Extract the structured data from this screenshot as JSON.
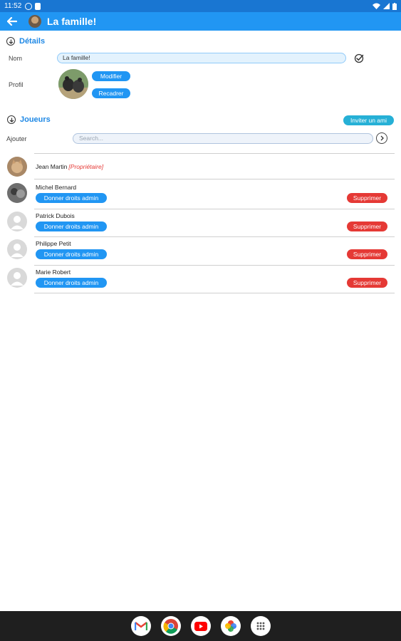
{
  "status_bar": {
    "time": "11:52"
  },
  "app_bar": {
    "title": "La famille!"
  },
  "details": {
    "heading": "Détails",
    "name_label": "Nom",
    "name_value": "La famille!",
    "profile_label": "Profil",
    "modify_label": "Modifier",
    "recrop_label": "Recadrer"
  },
  "players": {
    "heading": "Joueurs",
    "invite_label": "Inviter un ami",
    "add_label": "Ajouter",
    "search_placeholder": "Search...",
    "owner_tag": "[Propriétaire]",
    "admin_label": "Donner droits admin",
    "delete_label": "Supprimer",
    "list": [
      {
        "name": "Jean Martin",
        "owner": true,
        "avatar": "cat-photo"
      },
      {
        "name": "Michel Bernard",
        "avatar": "photo"
      },
      {
        "name": "Patrick Dubois",
        "avatar": "default-person"
      },
      {
        "name": "Philippe Petit",
        "avatar": "default-person"
      },
      {
        "name": "Marie Robert",
        "avatar": "default-person"
      }
    ]
  },
  "dock": [
    "gmail-icon",
    "chrome-icon",
    "youtube-icon",
    "photos-icon",
    "app-drawer-icon"
  ],
  "colors": {
    "primary": "#2196f3",
    "status_bar": "#1976d2",
    "danger": "#e53935",
    "invite": "#26b0d6"
  }
}
